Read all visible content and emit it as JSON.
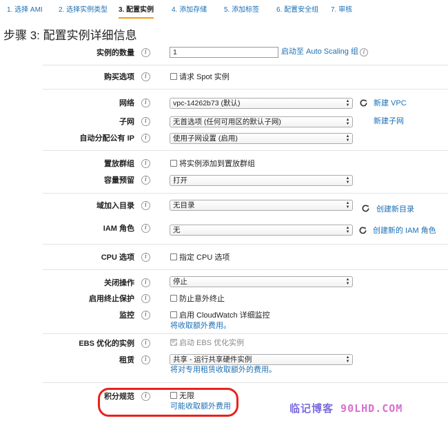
{
  "wizard": {
    "steps": [
      "1. 选择 AMI",
      "2. 选择实例类型",
      "3. 配置实例",
      "4. 添加存储",
      "5. 添加标签",
      "6. 配置安全组",
      "7. 审核"
    ]
  },
  "page_title": "步骤 3: 配置实例详细信息",
  "form": {
    "instance_count": {
      "label": "实例的数量",
      "value": "1",
      "link": "启动至 Auto Scaling 组"
    },
    "purchase": {
      "label": "购买选项",
      "checkbox": "请求 Spot 实例"
    },
    "network": {
      "label": "网络",
      "value": "vpc-14262b73 (默认)",
      "link": "新建 VPC"
    },
    "subnet": {
      "label": "子网",
      "value": "无首选项 (任何可用区的默认子网)",
      "link": "新建子网"
    },
    "public_ip": {
      "label": "自动分配公有 IP",
      "value": "使用子网设置 (启用)"
    },
    "placement": {
      "label": "置放群组",
      "checkbox": "将实例添加到置放群组"
    },
    "capacity": {
      "label": "容量预留",
      "value": "打开"
    },
    "domain": {
      "label": "域加入目录",
      "value": "无目录",
      "link": "创建新目录"
    },
    "iam": {
      "label": "IAM 角色",
      "value": "无",
      "link": "创建新的 IAM 角色"
    },
    "cpu": {
      "label": "CPU 选项",
      "checkbox": "指定 CPU 选项"
    },
    "shutdown": {
      "label": "关闭操作",
      "value": "停止"
    },
    "termination": {
      "label": "启用终止保护",
      "checkbox": "防止意外终止"
    },
    "monitoring": {
      "label": "监控",
      "checkbox": "启用 CloudWatch 详细监控",
      "note": "将收取额外费用。"
    },
    "ebs": {
      "label": "EBS 优化的实例",
      "checkbox": "启动 EBS 优化实例"
    },
    "tenancy": {
      "label": "租赁",
      "value": "共享 - 运行共享硬件实例",
      "note": "将对专用租赁收取额外的费用。"
    },
    "credit": {
      "label": "积分规范",
      "checkbox": "无限",
      "note": "可能收取额外费用"
    }
  },
  "watermark": {
    "part1": "临记博客",
    "part2": "90LHD.COM"
  },
  "icons": {
    "info": "i",
    "refresh": "refresh-icon"
  },
  "colors": {
    "link": "#1a6fb5",
    "active_tab_underline": "#f39c12",
    "highlight": "#e8211b"
  }
}
